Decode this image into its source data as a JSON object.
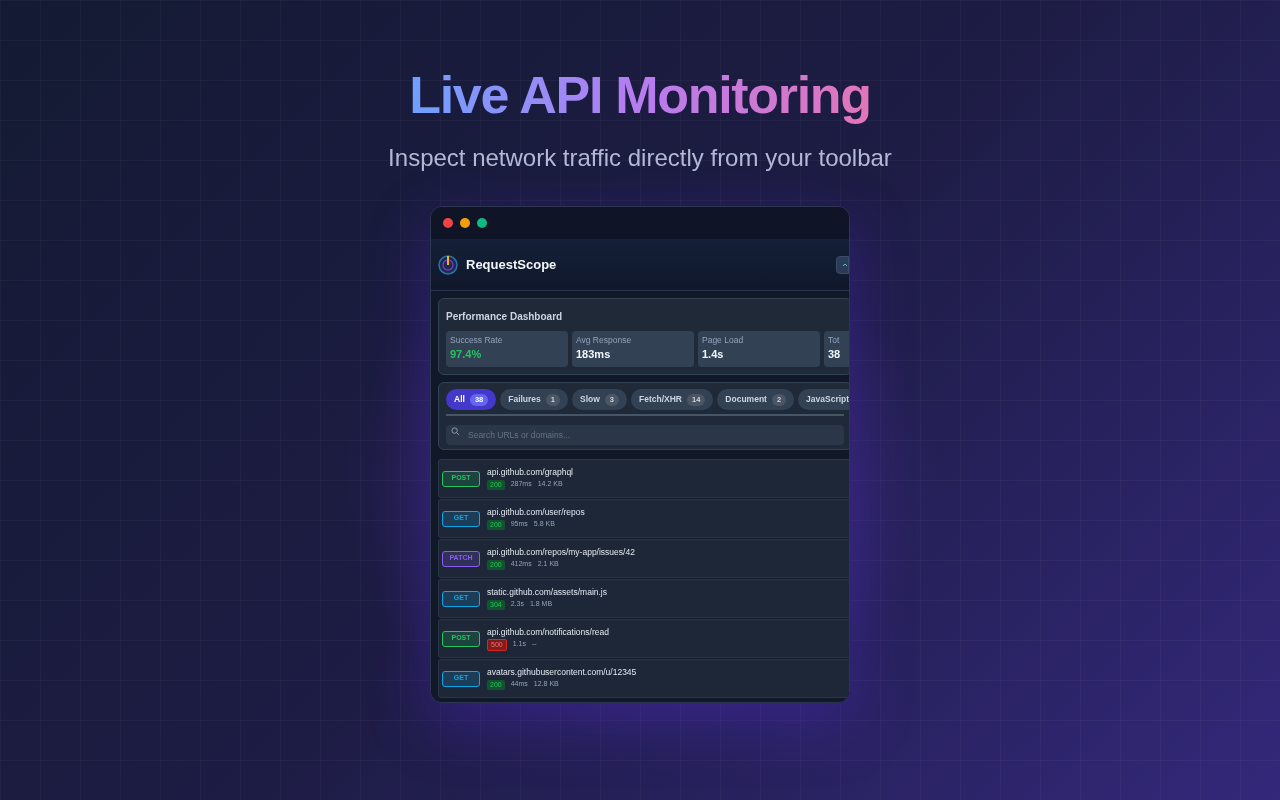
{
  "hero": {
    "title": "Live API Monitoring",
    "subtitle": "Inspect network traffic directly from your toolbar"
  },
  "app": {
    "name": "RequestScope"
  },
  "dashboard": {
    "title": "Performance Dashboard",
    "stats": [
      {
        "label": "Success Rate",
        "value": "97.4%",
        "color": "#22c55e"
      },
      {
        "label": "Avg Response",
        "value": "183ms",
        "color": "#f1f5f9"
      },
      {
        "label": "Page Load",
        "value": "1.4s",
        "color": "#f1f5f9"
      },
      {
        "label": "Tot",
        "value": "38",
        "color": "#f1f5f9"
      }
    ]
  },
  "filters": [
    {
      "label": "All",
      "count": "38",
      "selected": true
    },
    {
      "label": "Failures",
      "count": "1",
      "selected": false
    },
    {
      "label": "Slow",
      "count": "3",
      "selected": false
    },
    {
      "label": "Fetch/XHR",
      "count": "14",
      "selected": false
    },
    {
      "label": "Document",
      "count": "2",
      "selected": false
    },
    {
      "label": "JavaScript",
      "selected": false
    }
  ],
  "search": {
    "placeholder": "Search URLs or domains..."
  },
  "requests": [
    {
      "method": "POST",
      "color": "#22c55e",
      "url": "api.github.com/graphql",
      "status": "200",
      "failed": false,
      "time": "287ms",
      "size": "14.2 KB"
    },
    {
      "method": "GET",
      "color": "#0ea5e9",
      "url": "api.github.com/user/repos",
      "status": "200",
      "failed": false,
      "time": "95ms",
      "size": "5.8 KB"
    },
    {
      "method": "PATCH",
      "color": "#8b5cf6",
      "url": "api.github.com/repos/my-app/issues/42",
      "status": "200",
      "failed": false,
      "time": "412ms",
      "size": "2.1 KB"
    },
    {
      "method": "GET",
      "color": "#0ea5e9",
      "url": "static.github.com/assets/main.js",
      "status": "304",
      "failed": false,
      "time": "2.3s",
      "size": "1.8 MB"
    },
    {
      "method": "POST",
      "color": "#22c55e",
      "url": "api.github.com/notifications/read",
      "status": "500",
      "failed": true,
      "time": "1.1s",
      "size": "--"
    },
    {
      "method": "GET",
      "color": "#0ea5e9",
      "url": "avatars.githubusercontent.com/u/12345",
      "status": "200",
      "failed": false,
      "time": "44ms",
      "size": "12.8 KB"
    }
  ]
}
